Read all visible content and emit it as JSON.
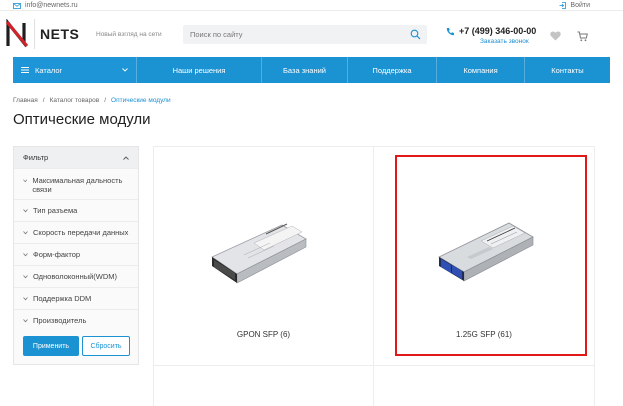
{
  "topbar": {
    "email": "info@newnets.ru",
    "login": "Войти"
  },
  "header": {
    "logo_text": "NETS",
    "slogan": "Новый взгляд на сети",
    "search_placeholder": "Поиск по сайту",
    "phone": "+7 (499) 346-00-00",
    "callback": "Заказать звонок"
  },
  "nav": {
    "catalog": "Каталог",
    "items": [
      "Наши решения",
      "База знаний",
      "Поддержка",
      "Компания",
      "Контакты"
    ]
  },
  "breadcrumb": [
    "Главная",
    "/",
    "Каталог товаров",
    "/",
    "Оптические модули"
  ],
  "page_title": "Оптические модули",
  "filter": {
    "title": "Фильтр",
    "items": [
      "Максимальная дальность связи",
      "Тип разъема",
      "Скорость передачи данных",
      "Форм-фактор",
      "Одноволоконный(WDM)",
      "Поддержка DDM",
      "Производитель"
    ],
    "apply": "Применить",
    "reset": "Сбросить"
  },
  "products": [
    {
      "name": "GPON SFP (6)",
      "highlighted": false
    },
    {
      "name": "1.25G SFP (61)",
      "highlighted": true
    }
  ],
  "colors": {
    "accent": "#1b92d2",
    "highlight": "#e01818",
    "logo_red": "#d3232a"
  }
}
